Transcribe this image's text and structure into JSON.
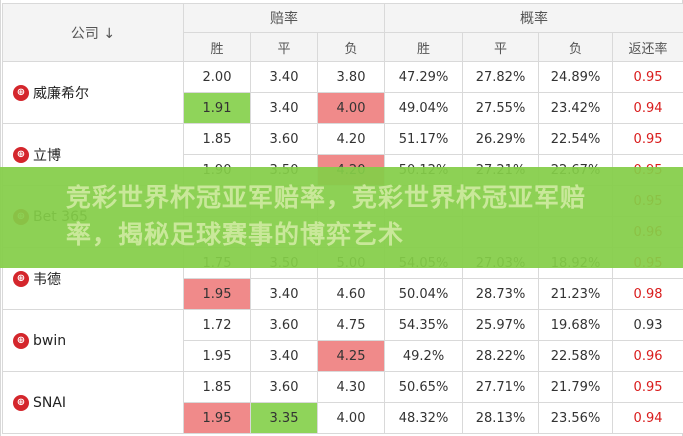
{
  "header": {
    "company_label": "公司 ↓",
    "group_odds": "赔率",
    "group_prob": "概率",
    "sub": [
      "胜",
      "平",
      "负",
      "胜",
      "平",
      "负",
      "返还率"
    ]
  },
  "rows": [
    {
      "company": "威廉希尔",
      "icon": "flag-icon",
      "lines": [
        {
          "o": [
            "2.00",
            "3.40",
            "3.80"
          ],
          "p": [
            "47.29%",
            "27.82%",
            "24.89%"
          ],
          "ret": "0.95"
        },
        {
          "o": [
            "1.91",
            "3.40",
            "4.00"
          ],
          "p": [
            "49.04%",
            "27.55%",
            "23.42%"
          ],
          "ret": "0.94"
        }
      ]
    },
    {
      "company": "立博",
      "icon": "flag-icon",
      "lines": [
        {
          "o": [
            "1.85",
            "3.60",
            "4.20"
          ],
          "p": [
            "51.17%",
            "26.29%",
            "22.54%"
          ],
          "ret": "0.95"
        },
        {
          "o": [
            "1.90",
            "3.50",
            "4.20"
          ],
          "p": [
            "50.12%",
            "27.21%",
            "22.67%"
          ],
          "ret": "0.95"
        }
      ]
    },
    {
      "company": "Bet 365",
      "icon": "flag-icon",
      "lines": [
        {
          "o": [
            "",
            "",
            ""
          ],
          "p": [
            "",
            "",
            ""
          ],
          "ret": "0.95"
        },
        {
          "o": [
            "",
            "",
            ""
          ],
          "p": [
            "",
            "",
            ""
          ],
          "ret": "0.96"
        }
      ]
    },
    {
      "company": "韦德",
      "icon": "flag-icon",
      "lines": [
        {
          "o": [
            "1.75",
            "3.50",
            "5.00"
          ],
          "p": [
            "54.05%",
            "27.03%",
            "18.92%"
          ],
          "ret": "0.95"
        },
        {
          "o": [
            "1.95",
            "3.40",
            "4.60"
          ],
          "p": [
            "50.04%",
            "28.73%",
            "21.23%"
          ],
          "ret": "0.98"
        }
      ]
    },
    {
      "company": "bwin",
      "icon": "flag-icon",
      "lines": [
        {
          "o": [
            "1.72",
            "3.60",
            "4.75"
          ],
          "p": [
            "54.35%",
            "25.97%",
            "19.68%"
          ],
          "ret": "0.93"
        },
        {
          "o": [
            "1.95",
            "3.40",
            "4.25"
          ],
          "p": [
            "49.2%",
            "28.22%",
            "22.58%"
          ],
          "ret": "0.96"
        }
      ]
    },
    {
      "company": "SNAI",
      "icon": "flag-icon",
      "lines": [
        {
          "o": [
            "1.85",
            "3.60",
            "4.30"
          ],
          "p": [
            "50.65%",
            "27.71%",
            "21.79%"
          ],
          "ret": "0.95"
        },
        {
          "o": [
            "1.95",
            "3.35",
            "4.00"
          ],
          "p": [
            "48.32%",
            "28.13%",
            "23.56%"
          ],
          "ret": "0.94"
        }
      ]
    }
  ],
  "highlights": {
    "0-1-0": "down",
    "0-1-2": "up",
    "1-1-2": "up",
    "3-1-0": "up",
    "4-1-2": "up",
    "5-1-0": "up",
    "5-1-1": "down"
  },
  "return_colors": {
    "0-0": "red",
    "0-1": "red",
    "1-0": "red",
    "1-1": "red",
    "2-0": "red",
    "2-1": "red",
    "3-0": "red",
    "3-1": "red",
    "4-0": "black",
    "4-1": "red",
    "5-0": "red",
    "5-1": "red"
  },
  "colors": {
    "up": "#f08a8a",
    "down": "#8fd45a",
    "return_red": "#d91c1c",
    "banner": "#84ce48",
    "flag": "#d4262c"
  },
  "ad_banner": {
    "text": "竞彩世界杯冠亚军赔率，竞彩世界杯冠亚军赔率，揭秘足球赛事的博弈艺术"
  }
}
